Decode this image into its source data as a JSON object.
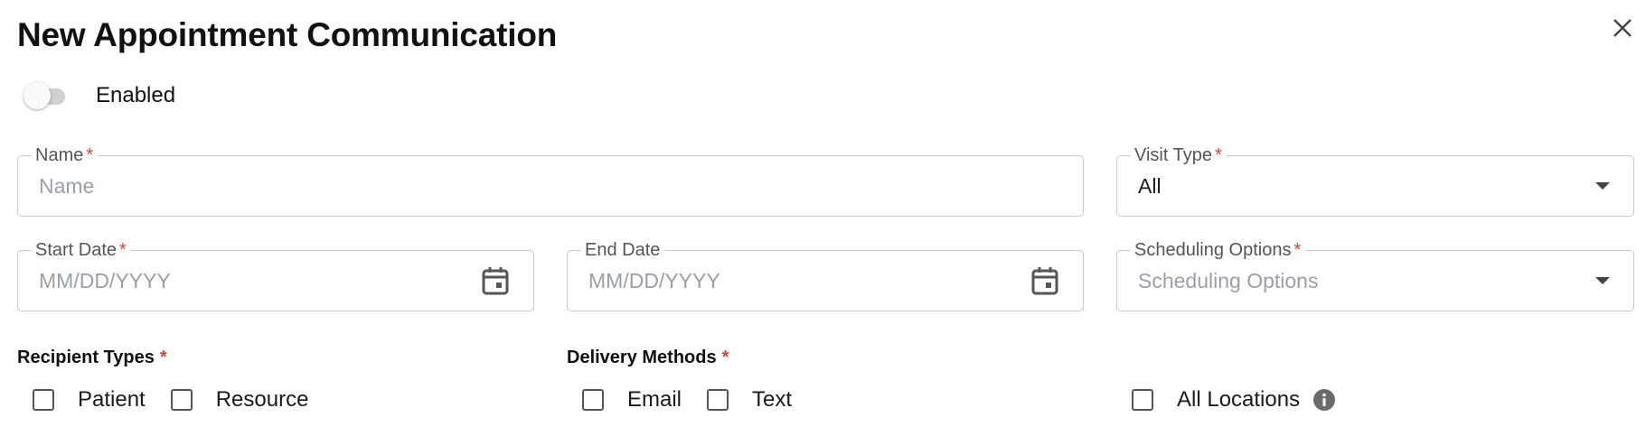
{
  "dialog": {
    "title": "New Appointment Communication",
    "close_icon": "close-icon"
  },
  "enabled_toggle": {
    "label": "Enabled",
    "on": false
  },
  "fields": {
    "name": {
      "label": "Name",
      "required_mark": "*",
      "placeholder": "Name",
      "value": ""
    },
    "visit_type": {
      "label": "Visit Type",
      "required_mark": "*",
      "value": "All"
    },
    "start_date": {
      "label": "Start Date",
      "required_mark": "*",
      "placeholder": "MM/DD/YYYY",
      "value": ""
    },
    "end_date": {
      "label": "End Date",
      "placeholder": "MM/DD/YYYY",
      "value": ""
    },
    "scheduling_options": {
      "label": "Scheduling Options",
      "required_mark": "*",
      "placeholder": "Scheduling Options",
      "value": ""
    }
  },
  "recipient_types": {
    "label": "Recipient Types",
    "required_mark": "*",
    "options": [
      {
        "label": "Patient",
        "checked": false
      },
      {
        "label": "Resource",
        "checked": false
      }
    ]
  },
  "delivery_methods": {
    "label": "Delivery Methods",
    "required_mark": "*",
    "options": [
      {
        "label": "Email",
        "checked": false
      },
      {
        "label": "Text",
        "checked": false
      }
    ]
  },
  "locations": {
    "all_locations": {
      "label": "All Locations",
      "checked": false,
      "info_icon": "info-icon"
    }
  },
  "colors": {
    "required": "#d9442c",
    "border": "#c8c8c8",
    "placeholder": "#9aa0a8",
    "icon": "#555555"
  }
}
